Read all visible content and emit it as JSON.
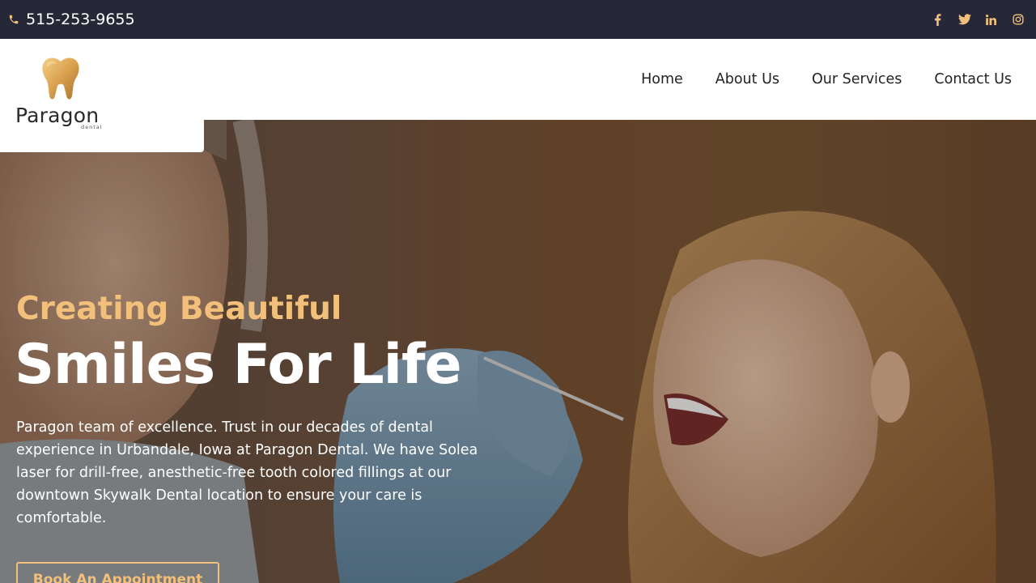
{
  "topbar": {
    "phone": "515-253-9655",
    "phone_icon": "phone-icon",
    "socials": [
      {
        "icon": "facebook-icon"
      },
      {
        "icon": "twitter-icon"
      },
      {
        "icon": "linkedin-icon"
      },
      {
        "icon": "instagram-icon"
      }
    ]
  },
  "logo": {
    "brand": "Paragon",
    "sub": "dental",
    "icon": "tooth-logo-icon"
  },
  "nav": {
    "items": [
      "Home",
      "About Us",
      "Our Services",
      "Contact Us"
    ]
  },
  "hero": {
    "kicker": "Creating Beautiful",
    "title": "Smiles For Life",
    "description": "Paragon team of excellence.  Trust in our decades of dental experience in Urbandale, Iowa at Paragon Dental.  We have Solea laser for drill-free, anesthetic-free tooth colored fillings at our downtown Skywalk Dental location to ensure your care is comfortable.",
    "cta": "Book An Appointment"
  },
  "colors": {
    "topbar_bg": "#262838",
    "accent": "#f2c07a",
    "nav_text": "#222222"
  }
}
